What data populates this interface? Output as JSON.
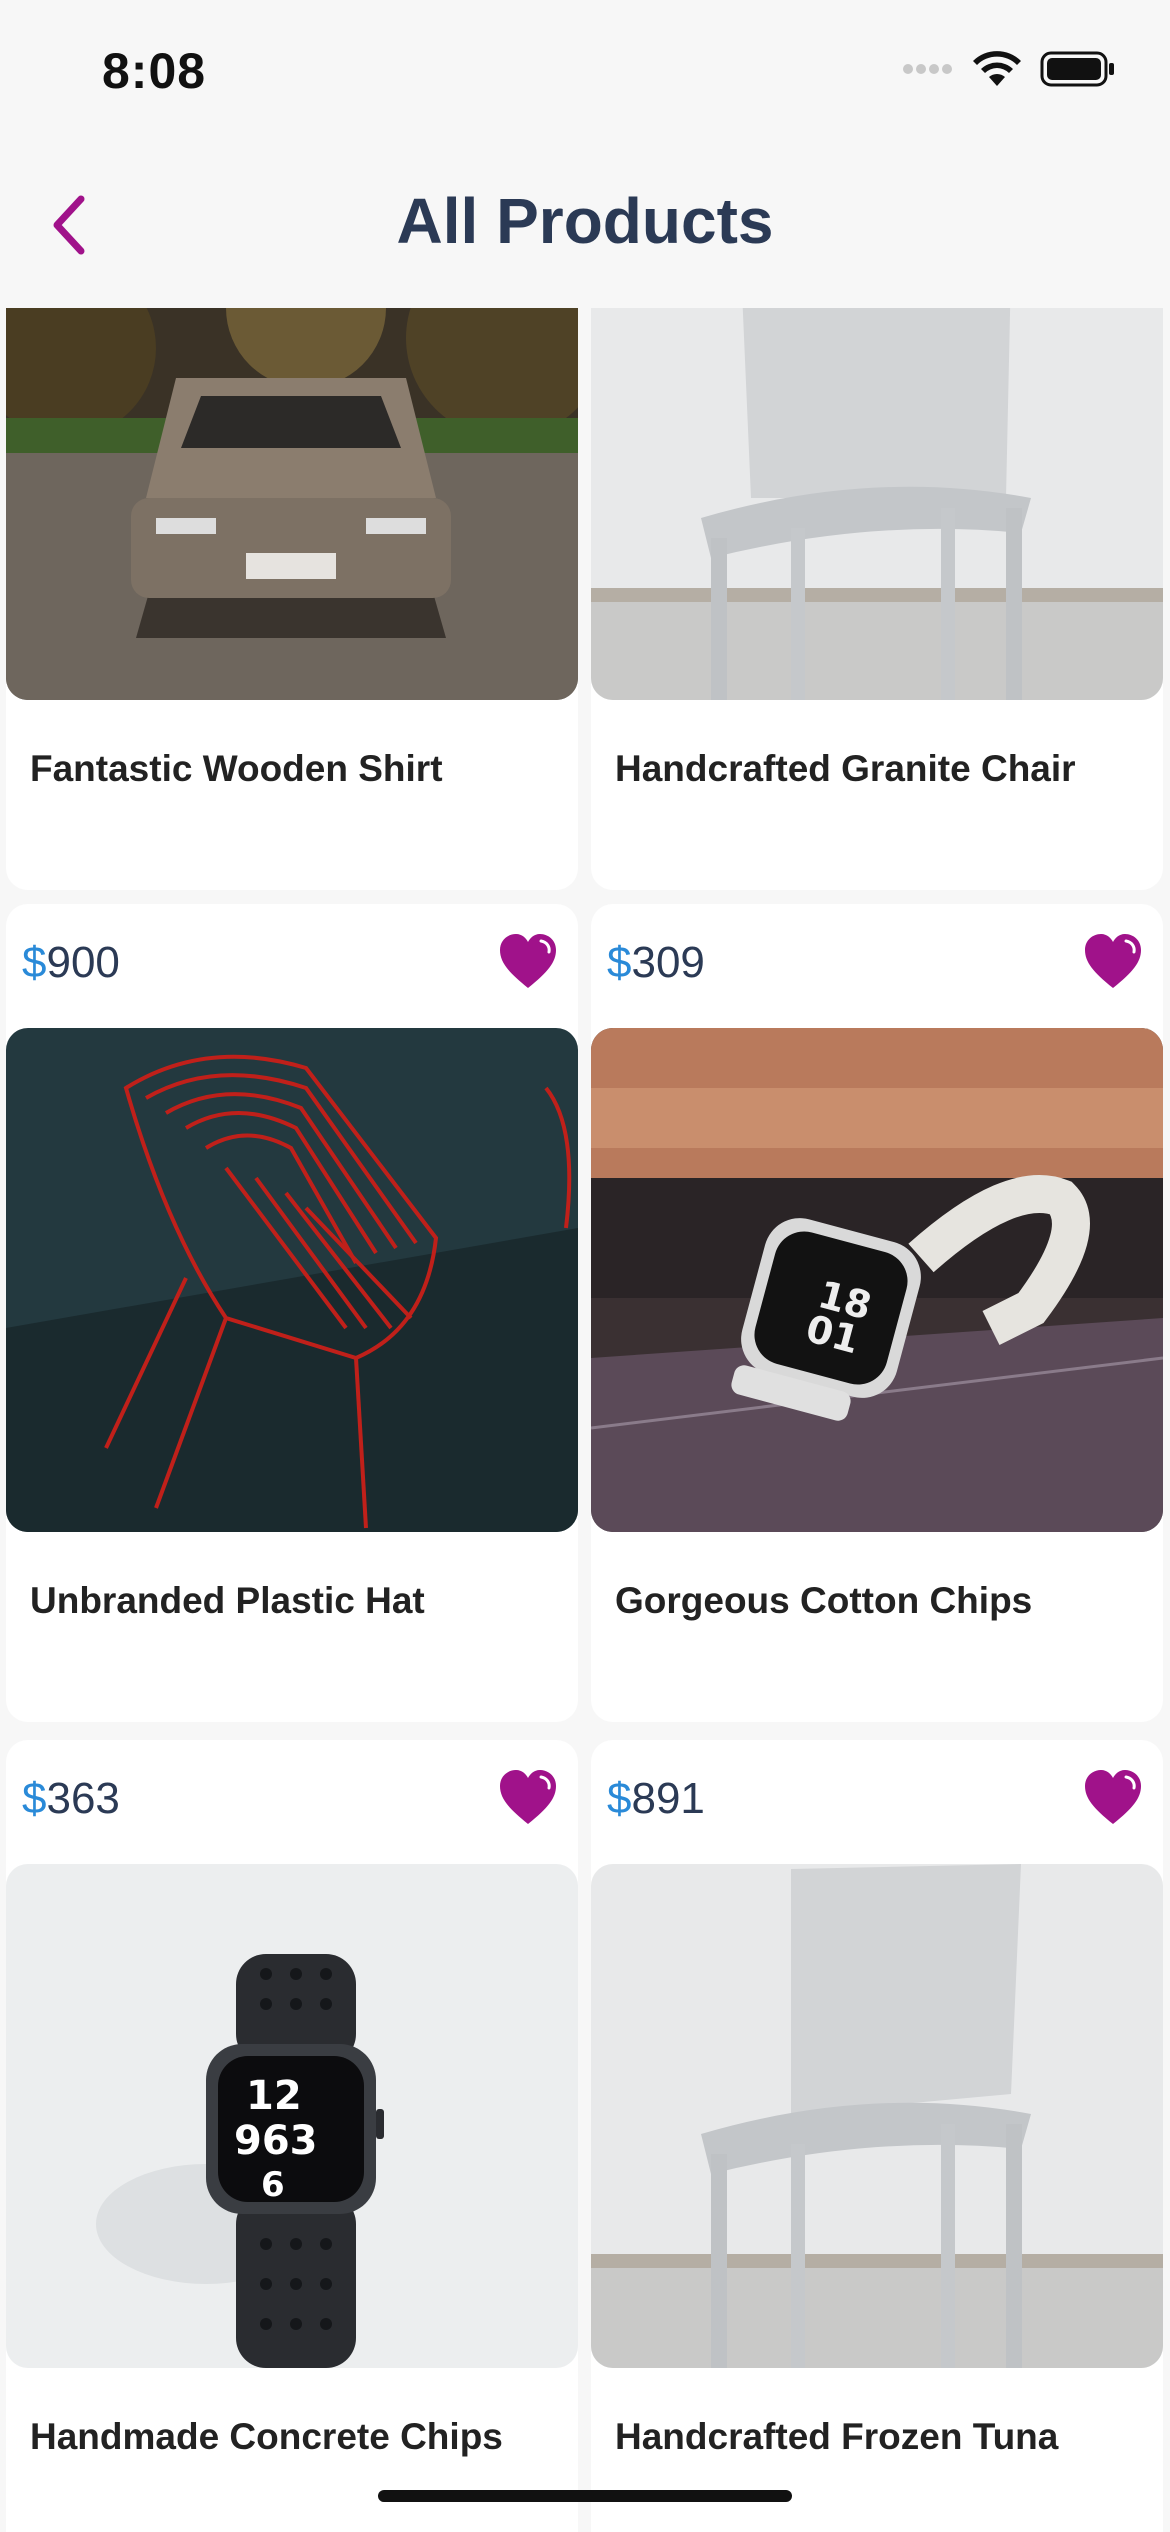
{
  "status_bar": {
    "time": "8:08"
  },
  "nav": {
    "title": "All Products"
  },
  "theme": {
    "accent": "#a0128a",
    "title_color": "#2b3a55",
    "currency_color": "#2a8ad8"
  },
  "products": [
    {
      "name": "Fantastic Wooden Shirt",
      "price": "",
      "currency": "",
      "image": "car-photo"
    },
    {
      "name": "Handcrafted Granite Chair",
      "price": "",
      "currency": "",
      "image": "chair-photo"
    },
    {
      "name": "Unbranded Plastic Hat",
      "price": "900",
      "currency": "$",
      "image": "red-wire-chair-photo"
    },
    {
      "name": "Gorgeous Cotton Chips",
      "price": "309",
      "currency": "$",
      "image": "white-watch-photo"
    },
    {
      "name": "Handmade Concrete Chips",
      "price": "363",
      "currency": "$",
      "image": "black-watch-photo"
    },
    {
      "name": "Handcrafted Frozen Tuna",
      "price": "891",
      "currency": "$",
      "image": "chair-photo"
    }
  ]
}
